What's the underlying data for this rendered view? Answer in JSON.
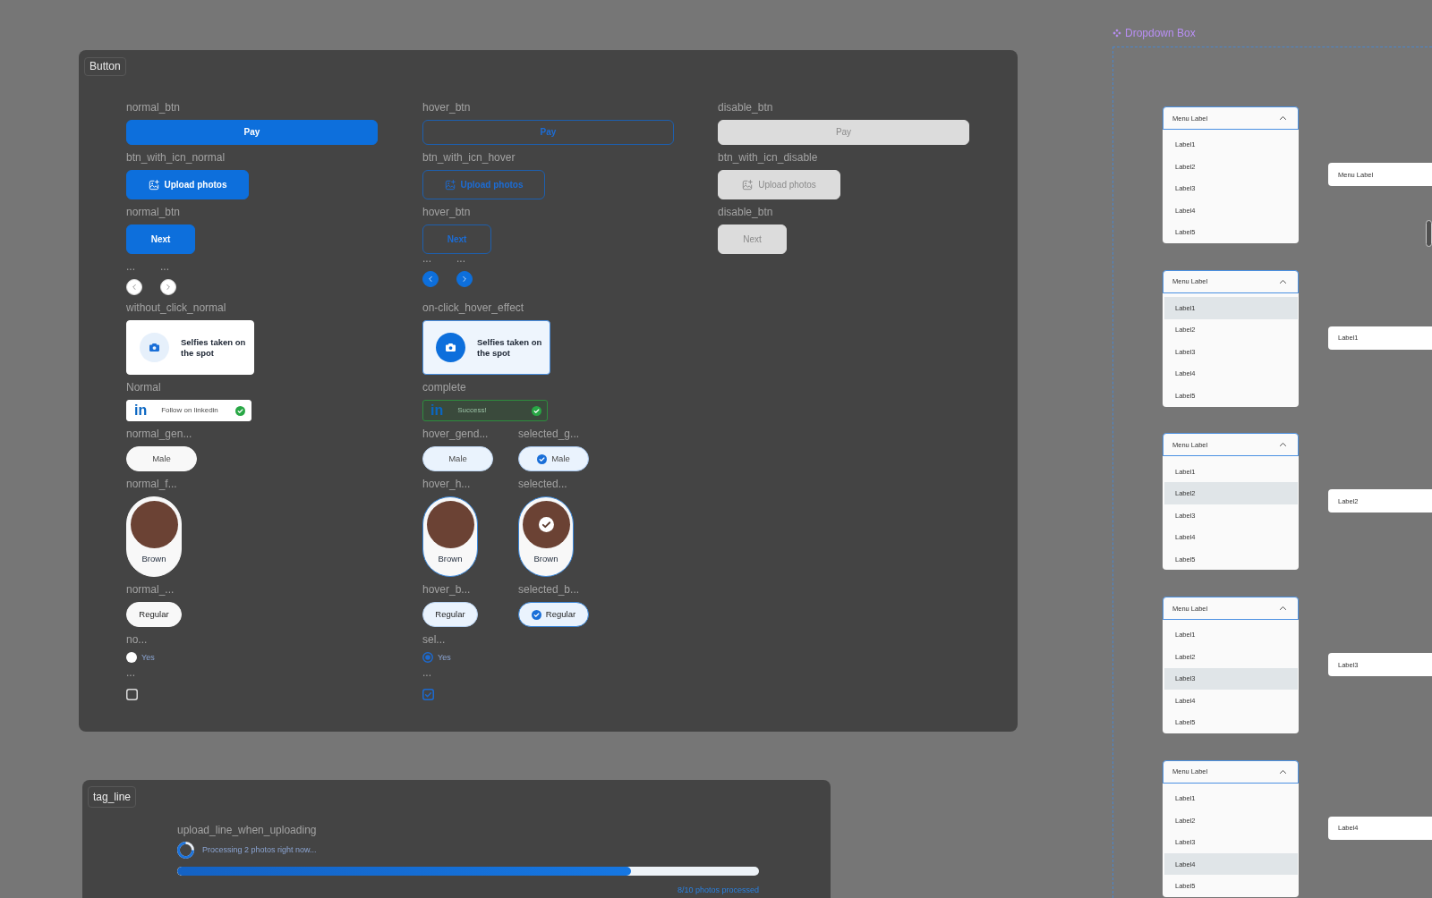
{
  "button_panel": {
    "title": "Button",
    "rows": [
      {
        "kind": "wide_button",
        "variants": [
          {
            "caption": "normal_btn",
            "hover": false,
            "disabled": false,
            "label": "Pay"
          },
          {
            "caption": "hover_btn",
            "hover": true,
            "disabled": false,
            "label": "Pay"
          },
          {
            "caption": "disable_btn",
            "disabled": true,
            "label": "Pay"
          }
        ]
      },
      {
        "kind": "icon_button",
        "variants": [
          {
            "caption": "btn_with_icn_normal",
            "hover": false,
            "disabled": false,
            "label": "Upload photos"
          },
          {
            "caption": "btn_with_icn_hover",
            "hover": true,
            "disabled": false,
            "label": "Upload photos"
          },
          {
            "caption": "btn_with_icn_disable",
            "disabled": true,
            "label": "Upload photos"
          }
        ]
      },
      {
        "kind": "compact_button",
        "variants": [
          {
            "caption": "normal_btn",
            "hover": false,
            "disabled": false,
            "label": "Next"
          },
          {
            "caption": "hover_btn",
            "hover": true,
            "disabled": false,
            "label": "Next"
          },
          {
            "caption": "disable_btn",
            "disabled": true,
            "label": "Next"
          }
        ]
      },
      {
        "kind": "arrow_buttons",
        "variants": [
          {
            "hover": false,
            "arrows": [
              {
                "kind": "previous",
                "caption": "..."
              },
              {
                "kind": "next",
                "caption": "..."
              }
            ]
          },
          {
            "hover": true,
            "arrows": [
              {
                "kind": "previous",
                "caption": "..."
              },
              {
                "kind": "next",
                "caption": "..."
              }
            ]
          }
        ]
      },
      {
        "kind": "option_card",
        "variants": [
          {
            "caption": "without_click_normal",
            "hover": false,
            "text": "Selfies taken on the spot"
          },
          {
            "caption": "on-click_hover_effect",
            "hover": true,
            "text": "Selfies taken on the spot"
          }
        ]
      },
      {
        "kind": "social_button",
        "variants": [
          {
            "caption": "Normal",
            "complete": false,
            "logo": "in",
            "text": "Follow on linkedin",
            "checked": true
          },
          {
            "caption": "complete",
            "complete": true,
            "logo": "in",
            "text": "Success!",
            "checked": true
          }
        ]
      },
      {
        "kind": "gender_pill",
        "variants": [
          {
            "caption": "normal_gen...",
            "hover": false,
            "selected": false,
            "label": "Male"
          },
          {
            "caption": "hover_gend...",
            "hover": true,
            "selected": false,
            "label": "Male"
          },
          {
            "caption": "selected_g...",
            "selected": true,
            "label": "Male"
          }
        ]
      },
      {
        "kind": "swatch",
        "variants": [
          {
            "caption": "normal_f...",
            "hover": false,
            "selected": false,
            "label": "Brown"
          },
          {
            "caption": "hover_h...",
            "hover": true,
            "selected": false,
            "label": "Brown"
          },
          {
            "caption": "selected...",
            "selected": true,
            "label": "Brown"
          }
        ]
      },
      {
        "kind": "chip",
        "variants": [
          {
            "caption": "normal_...",
            "hover": false,
            "selected": false,
            "label": "Regular"
          },
          {
            "caption": "hover_b...",
            "hover": true,
            "selected": false,
            "label": "Regular"
          },
          {
            "caption": "selected_b...",
            "selected": true,
            "label": "Regular"
          }
        ]
      },
      {
        "kind": "radio",
        "variants": [
          {
            "caption": "no...",
            "selected": false,
            "label": "Yes"
          },
          {
            "caption": "sel...",
            "selected": true,
            "label": "Yes"
          }
        ]
      },
      {
        "kind": "checkbox",
        "variants": [
          {
            "caption": "...",
            "checked": false
          },
          {
            "caption": "...",
            "checked": true
          }
        ]
      }
    ]
  },
  "tag_panel": {
    "title": "tag_line",
    "caption": "upload_line_when_uploading",
    "status": "Processing 2 photos right now...",
    "progress": {
      "level": 0.78
    },
    "count": "8/10 photos processed"
  },
  "dropdown_frame": {
    "title": "Dropdown Box",
    "variants": [
      {
        "header": "Menu Label",
        "expanded": true,
        "options": [
          {
            "label": "Label1",
            "selected": false
          },
          {
            "label": "Label2",
            "selected": false
          },
          {
            "label": "Label3",
            "selected": false
          },
          {
            "label": "Label4",
            "selected": false
          },
          {
            "label": "Label5",
            "selected": false
          }
        ],
        "field": "Menu Label"
      },
      {
        "header": "Menu Label",
        "expanded": true,
        "options": [
          {
            "label": "Label1",
            "selected": true
          },
          {
            "label": "Label2",
            "selected": false
          },
          {
            "label": "Label3",
            "selected": false
          },
          {
            "label": "Label4",
            "selected": false
          },
          {
            "label": "Label5",
            "selected": false
          }
        ],
        "field": "Label1"
      },
      {
        "header": "Menu Label",
        "expanded": true,
        "options": [
          {
            "label": "Label1",
            "selected": false
          },
          {
            "label": "Label2",
            "selected": true
          },
          {
            "label": "Label3",
            "selected": false
          },
          {
            "label": "Label4",
            "selected": false
          },
          {
            "label": "Label5",
            "selected": false
          }
        ],
        "field": "Label2"
      },
      {
        "header": "Menu Label",
        "expanded": true,
        "options": [
          {
            "label": "Label1",
            "selected": false
          },
          {
            "label": "Label2",
            "selected": false
          },
          {
            "label": "Label3",
            "selected": true
          },
          {
            "label": "Label4",
            "selected": false
          },
          {
            "label": "Label5",
            "selected": false
          }
        ],
        "field": "Label3"
      },
      {
        "header": "Menu Label",
        "expanded": true,
        "options": [
          {
            "label": "Label1",
            "selected": false
          },
          {
            "label": "Label2",
            "selected": false
          },
          {
            "label": "Label3",
            "selected": false
          },
          {
            "label": "Label4",
            "selected": true
          },
          {
            "label": "Label5",
            "selected": false
          }
        ],
        "field": "Label4"
      }
    ]
  }
}
